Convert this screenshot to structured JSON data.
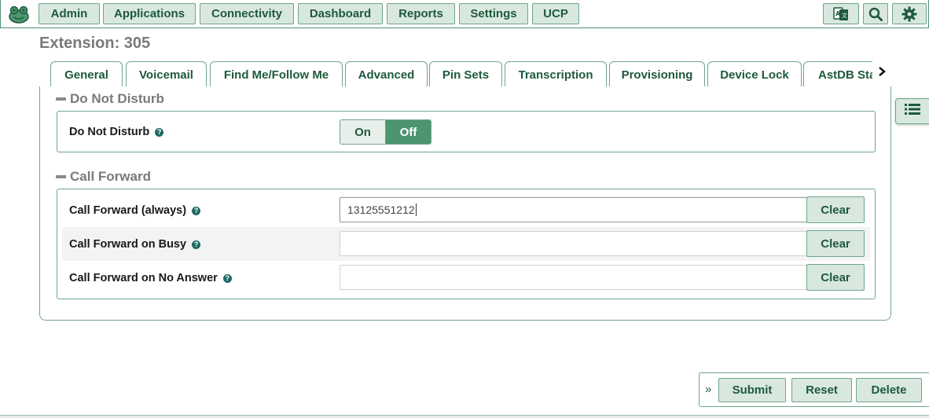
{
  "nav": {
    "items": [
      {
        "label": "Admin"
      },
      {
        "label": "Applications"
      },
      {
        "label": "Connectivity"
      },
      {
        "label": "Dashboard"
      },
      {
        "label": "Reports"
      },
      {
        "label": "Settings"
      },
      {
        "label": "UCP"
      }
    ],
    "icons": [
      "language-icon",
      "search-icon",
      "gear-icon"
    ]
  },
  "page": {
    "title": "Extension: 305"
  },
  "tabs": [
    {
      "label": "General"
    },
    {
      "label": "Voicemail"
    },
    {
      "label": "Find Me/Follow Me"
    },
    {
      "label": "Advanced"
    },
    {
      "label": "Pin Sets"
    },
    {
      "label": "Transcription"
    },
    {
      "label": "Provisioning"
    },
    {
      "label": "Device Lock"
    },
    {
      "label": "AstDB Sta"
    }
  ],
  "dnd": {
    "section_title": "Do Not Disturb",
    "label": "Do Not Disturb",
    "on_label": "On",
    "off_label": "Off",
    "selected": "Off"
  },
  "call_forward": {
    "section_title": "Call Forward",
    "rows": [
      {
        "label": "Call Forward (always)",
        "value": "13125551212",
        "clear_label": "Clear"
      },
      {
        "label": "Call Forward on Busy",
        "value": "",
        "clear_label": "Clear"
      },
      {
        "label": "Call Forward on No Answer",
        "value": "",
        "clear_label": "Clear"
      }
    ]
  },
  "actions": {
    "submit_label": "Submit",
    "reset_label": "Reset",
    "delete_label": "Delete"
  },
  "colors": {
    "accent": "#4d9470",
    "button_bg": "#d9e8df",
    "border": "#6ea58a",
    "text_accent": "#1d5a3c"
  }
}
